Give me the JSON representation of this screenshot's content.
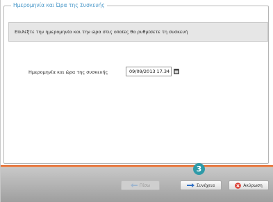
{
  "group": {
    "title": "Ημερομηνία και Ώρα της Συσκευής"
  },
  "instruction": "Επιλέξτε την ημερομηνία και την ώρα στις οποίες θα ρυθμίσετε τη συσκευή",
  "date_field": {
    "label": "Ημερομηνία και ώρα της συσκευής",
    "value": "09/09/2013 17.34"
  },
  "buttons": {
    "back": "Πίσω",
    "next": "Συνέχεια",
    "cancel": "Ακύρωση"
  },
  "step_badge": "3",
  "colors": {
    "accent_orange": "#e2682a",
    "title_blue": "#4a98c9",
    "badge_teal": "#2e9aa8",
    "cancel_red": "#d9362b"
  },
  "icons": {
    "back": "arrow-left-icon",
    "next": "arrow-right-icon",
    "cancel": "close-icon",
    "calendar": "calendar-icon"
  }
}
